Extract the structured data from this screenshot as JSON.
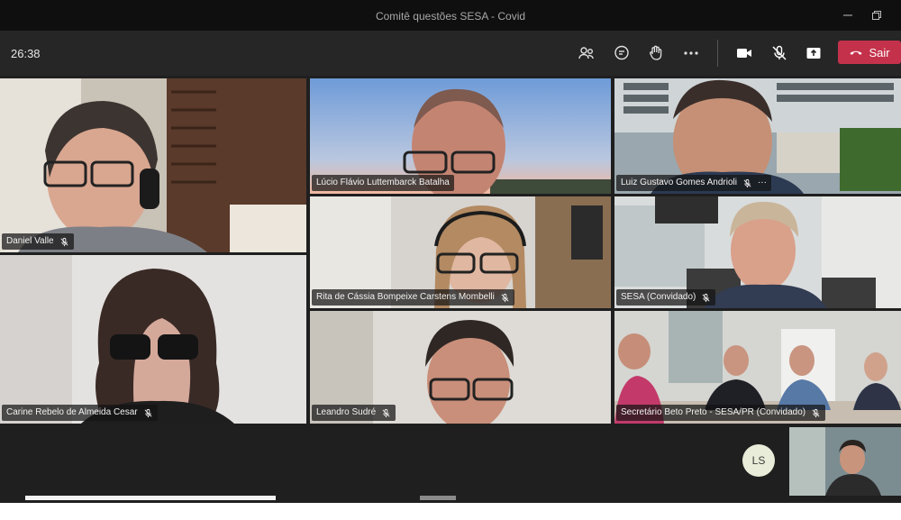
{
  "window": {
    "title": "Comitê questões SESA - Covid",
    "minimize_icon": "minimize-icon",
    "restore_icon": "restore-icon"
  },
  "toolbar": {
    "timer": "26:38",
    "icons": [
      "people-icon",
      "chat-icon",
      "raise-hand-icon",
      "more-icon",
      "camera-icon",
      "mic-off-icon",
      "share-icon"
    ],
    "leave_label": "Sair",
    "leave_color": "#c4314b"
  },
  "participants": [
    {
      "name": "Daniel Valle",
      "muted": true
    },
    {
      "name": "Lúcio Flávio Luttembarck Batalha",
      "muted": false
    },
    {
      "name": "Luiz Gustavo Gomes Andrioli",
      "muted": true
    },
    {
      "name": "Rita de Cássia Bompeixe Carstens Mombelli",
      "muted": true
    },
    {
      "name": "SESA (Convidado)",
      "muted": true
    },
    {
      "name": "Carine Rebelo de Almeida Cesar",
      "muted": true
    },
    {
      "name": "Leandro Sudré",
      "muted": true
    },
    {
      "name": "Secretário Beto Preto - SESA/PR (Convidado)",
      "muted": true
    }
  ],
  "tile_more": "···",
  "overflow": {
    "avatar_initials": "LS",
    "avatar_color": "#e8ecd8"
  }
}
